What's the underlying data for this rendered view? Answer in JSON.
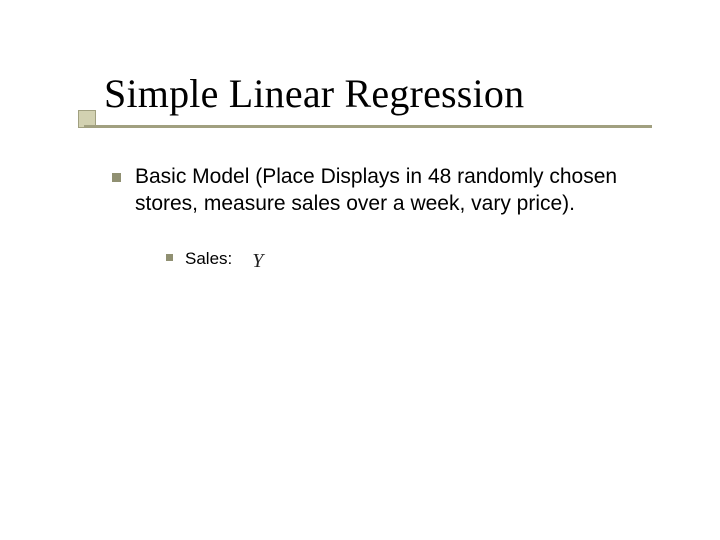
{
  "title": "Simple Linear Regression",
  "bullets": {
    "main": "Basic Model (Place Displays in 48 randomly chosen stores, measure sales over a week, vary price).",
    "sub": {
      "label": "Sales:",
      "variable": "Y"
    }
  }
}
